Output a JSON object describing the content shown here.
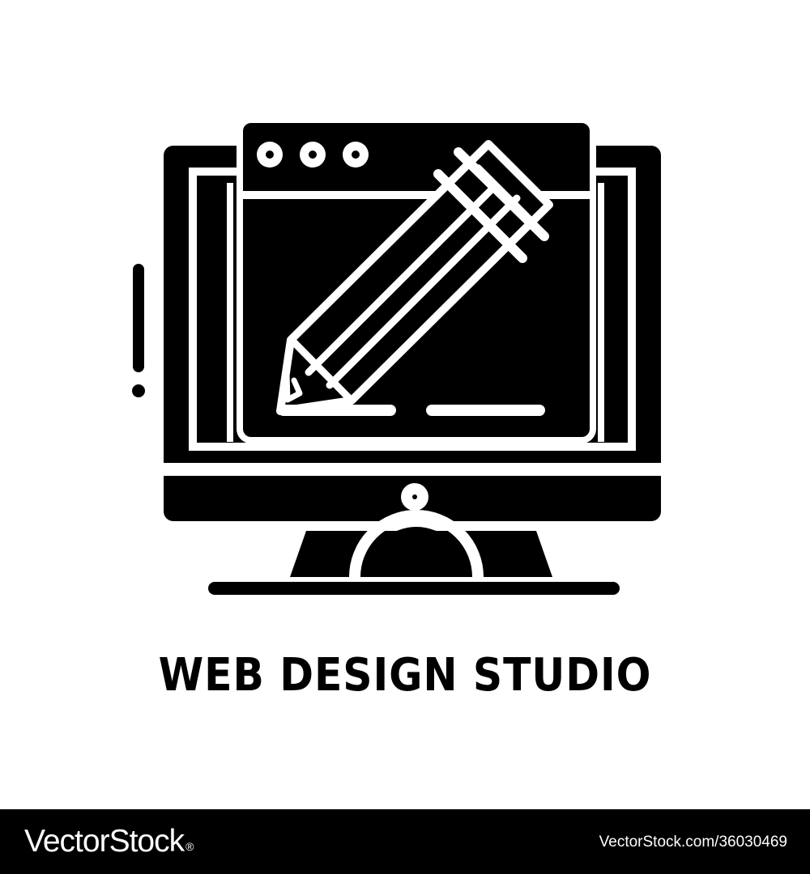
{
  "caption": "WEB DESIGN STUDIO",
  "footer": {
    "brand": "VectorStock",
    "brand_mark": "®",
    "image_id": "VectorStock.com/36030469"
  },
  "icon": {
    "name": "web-design-monitor-pencil-icon",
    "fill": "#000000",
    "stroke": "#ffffff"
  },
  "colors": {
    "background": "#ffffff",
    "foreground": "#000000",
    "footer_bg": "#000000",
    "footer_text": "#ffffff"
  }
}
